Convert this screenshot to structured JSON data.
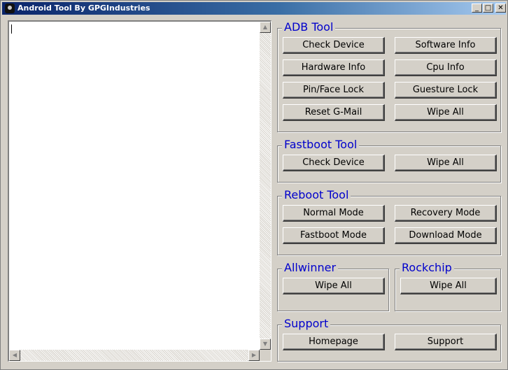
{
  "window": {
    "title": "Android Tool By GPGIndustries",
    "minimize": "_",
    "maximize": "□",
    "close": "✕"
  },
  "log": {
    "text": ""
  },
  "adb": {
    "title": "ADB Tool",
    "check_device": "Check Device",
    "software_info": "Software Info",
    "hardware_info": "Hardware Info",
    "cpu_info": "Cpu Info",
    "pin_face_lock": "Pin/Face Lock",
    "guesture_lock": "Guesture Lock",
    "reset_gmail": "Reset G-Mail",
    "wipe_all": "Wipe All"
  },
  "fastboot": {
    "title": "Fastboot Tool",
    "check_device": "Check Device",
    "wipe_all": "Wipe All"
  },
  "reboot": {
    "title": "Reboot Tool",
    "normal_mode": "Normal Mode",
    "recovery_mode": "Recovery Mode",
    "fastboot_mode": "Fastboot Mode",
    "download_mode": "Download Mode"
  },
  "allwinner": {
    "title": "Allwinner",
    "wipe_all": "Wipe All"
  },
  "rockchip": {
    "title": "Rockchip",
    "wipe_all": "Wipe All"
  },
  "support": {
    "title": "Support",
    "homepage": "Homepage",
    "support": "Support"
  },
  "scroll": {
    "up": "▲",
    "down": "▼",
    "left": "◀",
    "right": "▶"
  },
  "colors": {
    "title_bar": "#0a246a",
    "group_title": "#0000cc",
    "face": "#d4d0c8"
  }
}
